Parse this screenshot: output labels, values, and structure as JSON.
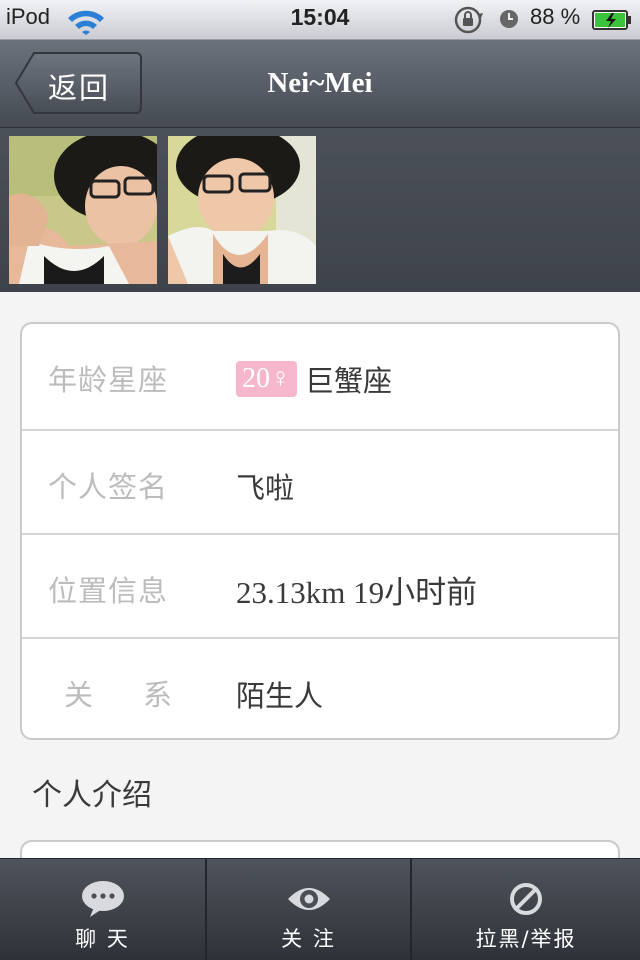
{
  "status_bar": {
    "carrier": "iPod",
    "time": "15:04",
    "battery": "88 %"
  },
  "nav": {
    "back_label": "返回",
    "title": "Nei~Mei"
  },
  "photos": [
    {
      "name": "profile-photo-1"
    },
    {
      "name": "profile-photo-2"
    }
  ],
  "profile": {
    "age_constellation": {
      "label": "年龄星座",
      "age_badge": "20♀",
      "constellation": "巨蟹座"
    },
    "signature": {
      "label": "个人签名",
      "value": "飞啦"
    },
    "location": {
      "label": "位置信息",
      "value": "23.13km 19小时前"
    },
    "relation": {
      "label": "关 系",
      "value": "陌生人"
    }
  },
  "intro": {
    "title": "个人介绍"
  },
  "tabs": [
    {
      "label": "聊 天",
      "icon": "chat-bubble-icon"
    },
    {
      "label": "关 注",
      "icon": "eye-icon"
    },
    {
      "label": "拉黑/举报",
      "icon": "block-icon"
    }
  ],
  "colors": {
    "nav_bg": "#545a63",
    "age_badge_bg": "#f6b6cb",
    "label_text": "#bcbcbc",
    "value_text": "#3a3a3a"
  }
}
